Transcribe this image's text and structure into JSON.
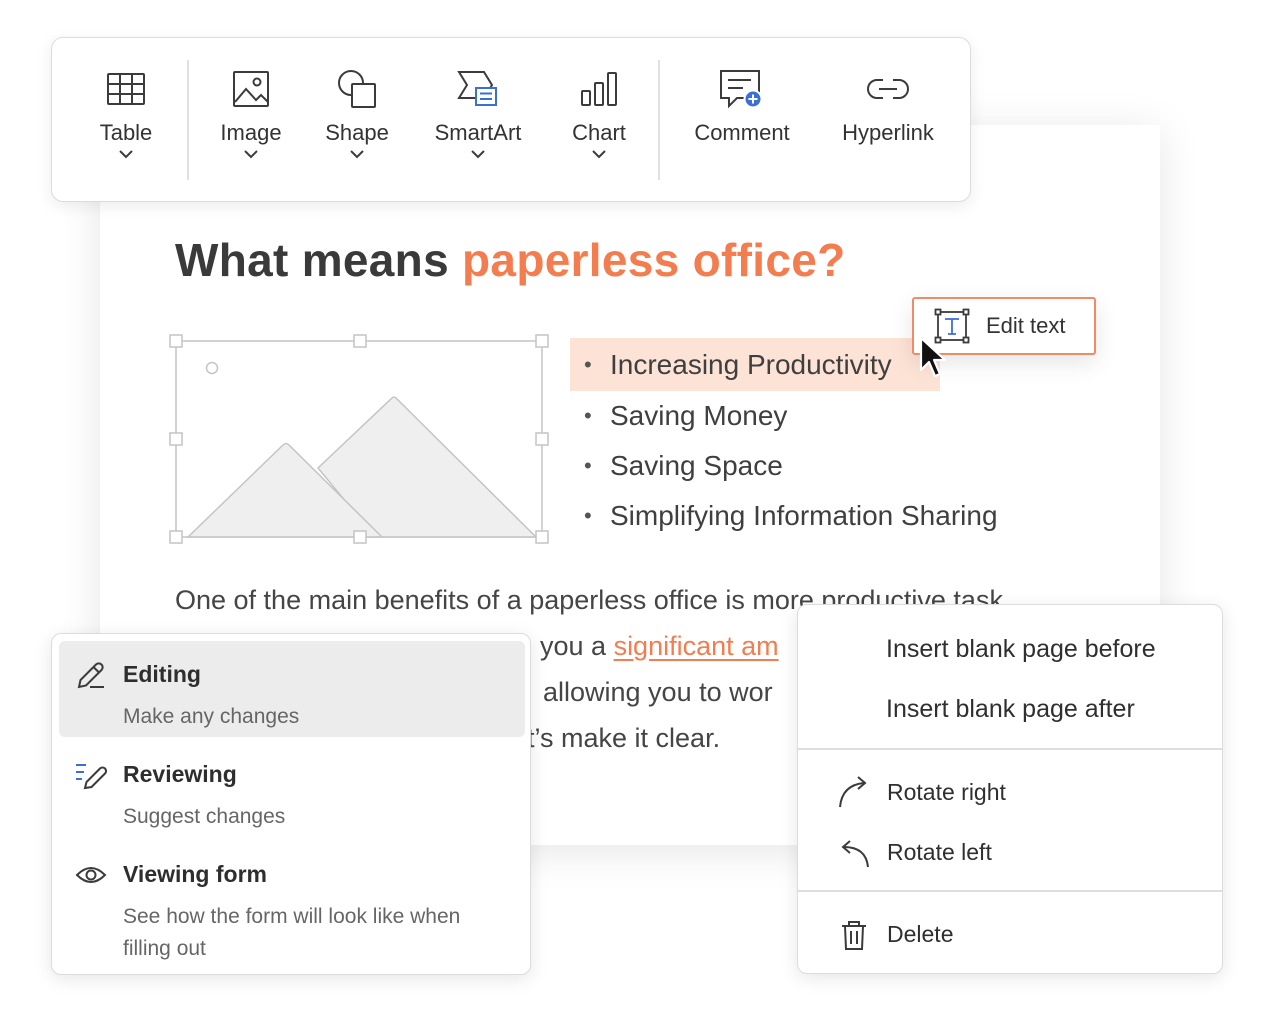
{
  "toolbar": {
    "items": [
      {
        "label": "Table",
        "icon": "table-icon",
        "has_dropdown": true
      },
      {
        "label": "Image",
        "icon": "image-icon",
        "has_dropdown": true
      },
      {
        "label": "Shape",
        "icon": "shape-icon",
        "has_dropdown": true
      },
      {
        "label": "SmartArt",
        "icon": "smartart-icon",
        "has_dropdown": true
      },
      {
        "label": "Chart",
        "icon": "chart-icon",
        "has_dropdown": true
      },
      {
        "label": "Comment",
        "icon": "comment-add-icon",
        "has_dropdown": false
      },
      {
        "label": "Hyperlink",
        "icon": "link-icon",
        "has_dropdown": false
      }
    ]
  },
  "document": {
    "title_prefix": "What means ",
    "title_accent": "paperless office?",
    "bullets": [
      "Increasing Productivity",
      "Saving Money",
      "Saving Space",
      "Simplifying Information Sharing"
    ],
    "body_lines": [
      "One of the main benefits of a paperless office is more productive task",
      "you a ",
      "significant am",
      "allowing you to wor",
      "t’s make it clear."
    ]
  },
  "edit_text": {
    "label": "Edit text",
    "icon": "text-box-icon"
  },
  "mode_menu": {
    "items": [
      {
        "title": "Editing",
        "description": "Make any changes",
        "icon": "pencil-icon",
        "active": true
      },
      {
        "title": "Reviewing",
        "description": "Suggest changes",
        "icon": "review-pencil-icon",
        "active": false
      },
      {
        "title": "Viewing form",
        "description": "See how the form will look like when filling out",
        "icon": "eye-icon",
        "active": false
      }
    ]
  },
  "page_menu": {
    "insert_before": "Insert blank page before",
    "insert_after": "Insert blank page after",
    "rotate_right": "Rotate right",
    "rotate_left": "Rotate left",
    "delete": "Delete"
  },
  "colors": {
    "accent": "#f37d4f",
    "highlight": "#fde2d6",
    "active_item": "#ececec",
    "icon_blue": "#3a6fd8"
  }
}
